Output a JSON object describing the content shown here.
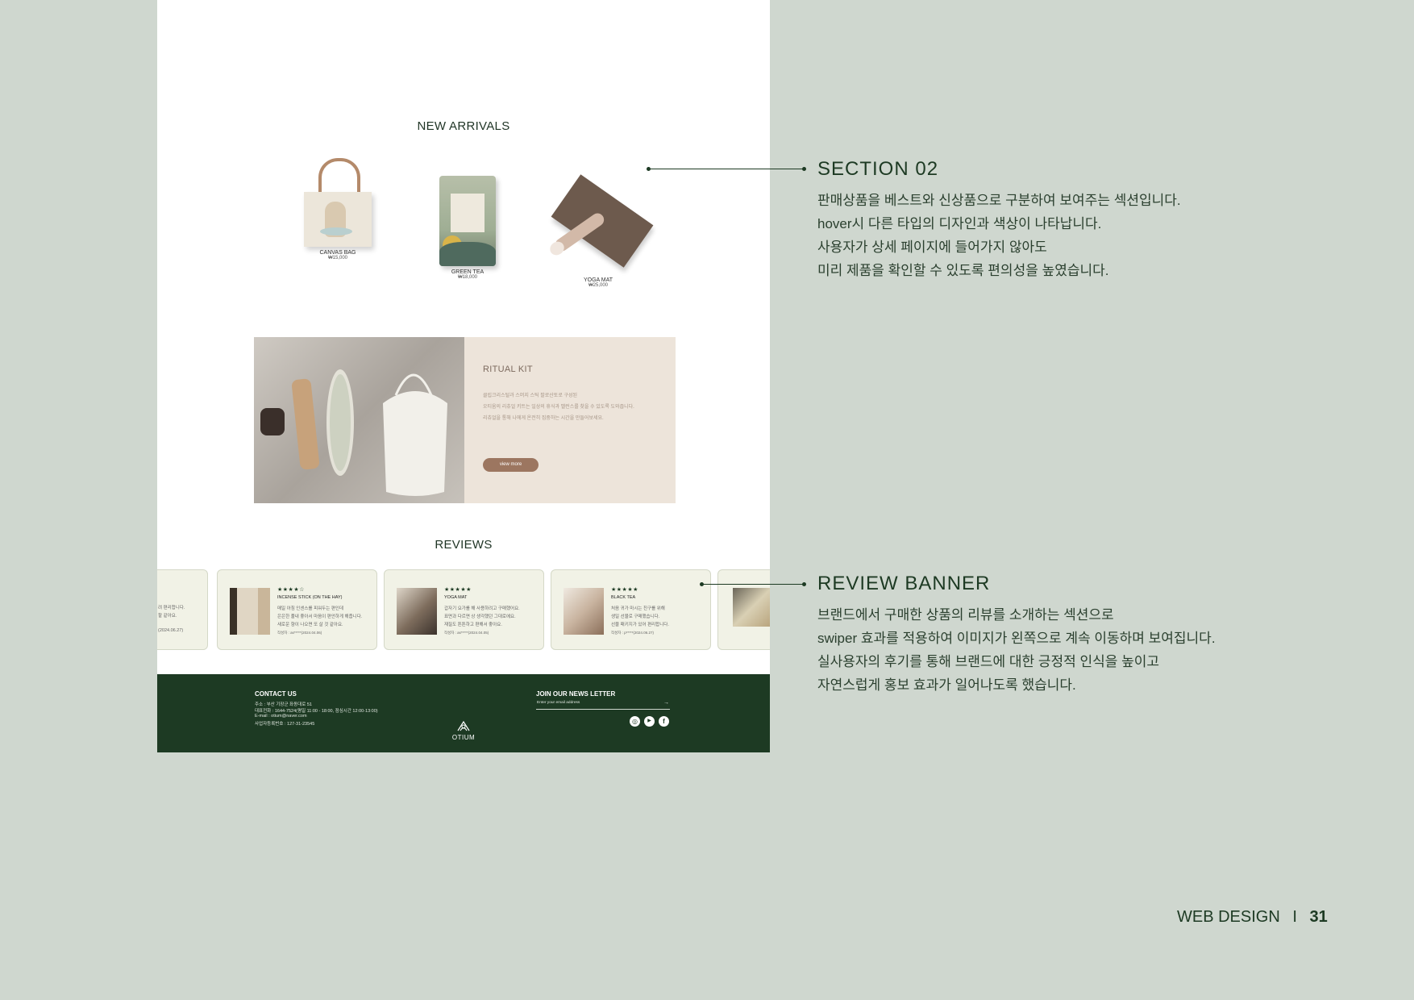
{
  "mockup": {
    "new_arrivals_title": "NEW ARRIVALS",
    "products": [
      {
        "name": "CANVAS BAG",
        "price": "₩15,000"
      },
      {
        "name": "GREEN TEA",
        "price": "₩18,000"
      },
      {
        "name": "YOGA MAT",
        "price": "₩25,000"
      }
    ],
    "ritual_kit": {
      "title": "RITUAL KIT",
      "lines": [
        "클립크리스털과 스머지 스틱 팔로산토로 구성된",
        "오티움의 리츄얼 키트는 일상의 휴식과 밸런스를 찾을 수 있도록 도와줍니다.",
        "리츄얼을 통해 나에게 온전히 집중하는 시간을 만들어보세요."
      ],
      "button": "view more"
    },
    "reviews_title": "REVIEWS",
    "review_cards": [
      {
        "stars": "★★★★☆",
        "title": "INCENSE STICK (ON THE HAY)",
        "lines": [
          "매일 아침 인센스를 피워두는 편인데",
          "은은한 풀내 좋아서 마음이 편안하게 해줍니다.",
          "새로운 향이 나오면 또 살 것 같아요."
        ],
        "meta": "작성자 : as*****(2024.04.06)"
      },
      {
        "stars": "★★★★★",
        "title": "YOGA MAT",
        "lines": [
          "갑자기 요가를 해 사용하려고 구매했어요.",
          "표면과 다르면 상 생각했던 그대로에요.",
          "재질도 튼튼하고 편해서 좋아요."
        ],
        "meta": "작성자 : as*****(2024.04.05)"
      },
      {
        "stars": "★★★★★",
        "title": "BLACK TEA",
        "lines": [
          "처음 귀가 마시는 친구를 위해",
          "생일 선물로 구매했습니다.",
          "선물 패키지가 있어 편리합니다."
        ],
        "meta": "작성자 : p*****(2024.06.27)"
      }
    ],
    "partial_card_lines": [
      "려 편리합니다.",
      "할 같아요."
    ],
    "partial_card_meta": "(2024.06.27)",
    "footer": {
      "contact_title": "CONTACT US",
      "contact_lines": [
        "주소 : 부산 기장군 좌동대로 51",
        "대표전화 : 1644-7524(평일 11:00 - 18:00, 점심시간 12:00-13:00)",
        "E-mail : otium@naver.com",
        "사업자등록번호 : 127-31-23545"
      ],
      "logo_text": "OTIUM",
      "newsletter_title": "JOIN OUR NEWS LETTER",
      "newsletter_placeholder": "Enter your email address",
      "newsletter_arrow": "→",
      "social_icons": [
        "instagram-icon",
        "youtube-icon",
        "facebook-icon"
      ]
    }
  },
  "annotations": {
    "section02": {
      "title": "SECTION 02",
      "lines": [
        "판매상품을 베스트와 신상품으로 구분하여 보여주는 섹션입니다.",
        "hover시 다른 타입의 디자인과 색상이 나타납니다.",
        "사용자가 상세 페이지에 들어가지 않아도",
        "미리 제품을 확인할 수 있도록 편의성을 높였습니다."
      ]
    },
    "review_banner": {
      "title": "REVIEW BANNER",
      "lines": [
        "브랜드에서 구매한 상품의 리뷰를 소개하는 섹션으로",
        "swiper 효과를 적용하여 이미지가 왼쪽으로 계속 이동하며 보여집니다.",
        "실사용자의 후기를 통해 브랜드에 대한 긍정적 인식을 높이고",
        "자연스럽게 홍보 효과가 일어나도록 했습니다."
      ]
    }
  },
  "page_footer": {
    "label": "WEB DESIGN",
    "separator": "I",
    "page_number": "31"
  },
  "colors": {
    "background": "#cfd7cf",
    "brand_green": "#1d3a23",
    "ritual_pane": "#ede4da",
    "button_brown": "#9c7660",
    "review_card": "#f1f2e6"
  }
}
